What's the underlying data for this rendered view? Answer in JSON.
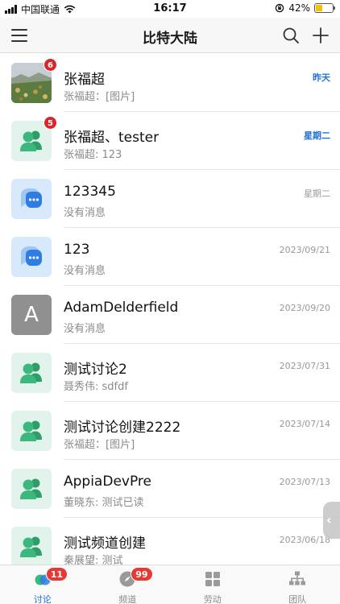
{
  "status_bar": {
    "carrier": "中国联通",
    "time": "16:17",
    "battery": "42%",
    "battery_level": 0.42
  },
  "header": {
    "title": "比特大陆",
    "icons": [
      "menu-icon",
      "search-icon",
      "plus-icon"
    ]
  },
  "conversations": [
    {
      "title": "张福超",
      "preview": "张福超：[图片]",
      "time": "昨天",
      "badge": "6",
      "avatar": "photo",
      "time_highlight": true
    },
    {
      "title": "张福超、tester",
      "preview": "张福超: 123",
      "time": "星期二",
      "badge": "5",
      "avatar": "group-icon",
      "time_highlight": true
    },
    {
      "title": "123345",
      "preview": "没有消息",
      "time": "星期二",
      "badge": "",
      "avatar": "chat-icon",
      "time_highlight": false
    },
    {
      "title": "123",
      "preview": "没有消息",
      "time": "2023/09/21",
      "badge": "",
      "avatar": "chat-icon",
      "time_highlight": false
    },
    {
      "title": "AdamDelderfield",
      "preview": "没有消息",
      "time": "2023/09/20",
      "badge": "",
      "avatar": "letter",
      "avatar_letter": "A",
      "time_highlight": false
    },
    {
      "title": "测试讨论2",
      "preview": "聂秀伟: sdfdf",
      "time": "2023/07/31",
      "badge": "",
      "avatar": "group-icon",
      "time_highlight": false
    },
    {
      "title": "测试讨论创建2222",
      "preview": "张福超：[图片]",
      "time": "2023/07/14",
      "badge": "",
      "avatar": "group-icon",
      "time_highlight": false
    },
    {
      "title": "AppiaDevPre",
      "preview": "董晓东: 测试已读",
      "time": "2023/07/13",
      "badge": "",
      "avatar": "group-icon",
      "time_highlight": false
    },
    {
      "title": "测试频道创建",
      "preview": "秦展望: 测试",
      "time": "2023/06/18",
      "badge": "",
      "avatar": "group-icon",
      "time_highlight": false
    }
  ],
  "tabs": [
    {
      "label": "讨论",
      "icon": "discussion-icon",
      "badge": "11",
      "active": true
    },
    {
      "label": "频道",
      "icon": "compass-icon",
      "badge": "99",
      "active": false
    },
    {
      "label": "劳动",
      "icon": "grid-icon",
      "badge": "",
      "active": false
    },
    {
      "label": "团队",
      "icon": "org-chart-icon",
      "badge": "",
      "active": false
    }
  ],
  "colors": {
    "accent": "#1e6fd9",
    "badge": "#d8262a",
    "group_avatar_bg": "#e2f3ec",
    "group_icon": "#3cb87f",
    "chat_avatar_bg": "#d7e9fb",
    "chat_icon": "#2f7de1"
  }
}
